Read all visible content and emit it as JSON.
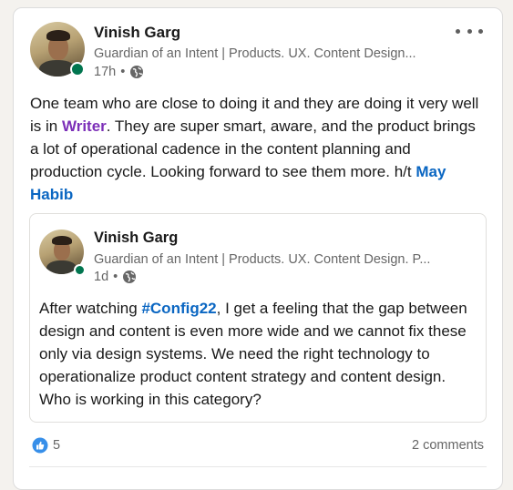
{
  "post": {
    "author": {
      "name": "Vinish Garg",
      "headline": "Guardian of an Intent | Products. UX. Content Design...",
      "time": "17h",
      "visibility_icon": "globe-icon",
      "online": true
    },
    "more_icon": "more-horizontal-icon",
    "text": {
      "part1": "One team who are close to doing it and they are doing it very well is in ",
      "mention": "Writer",
      "part2": ". They are super smart, aware, and the product brings a lot of operational cadence in the content planning and production cycle. Looking forward to see them more. h/t ",
      "mention2": "May Habib"
    },
    "reshared": {
      "author": {
        "name": "Vinish Garg",
        "headline": "Guardian of an Intent | Products. UX. Content Design. P...",
        "time": "1d",
        "visibility_icon": "globe-icon",
        "online": true
      },
      "text": {
        "part1": "After watching ",
        "hashtag": "#Config22",
        "part2": ", I get a feeling that the gap between design and content is even more wide and we cannot fix these only via design systems. We need the right technology to operationalize product content strategy and content design. Who is working in this category?"
      }
    },
    "social": {
      "reaction_icon": "like-icon",
      "reaction_count": "5",
      "comments": "2 comments"
    },
    "colors": {
      "link": "#0a66c2",
      "company_mention": "#7c2fb8",
      "presence": "#01754f"
    }
  }
}
